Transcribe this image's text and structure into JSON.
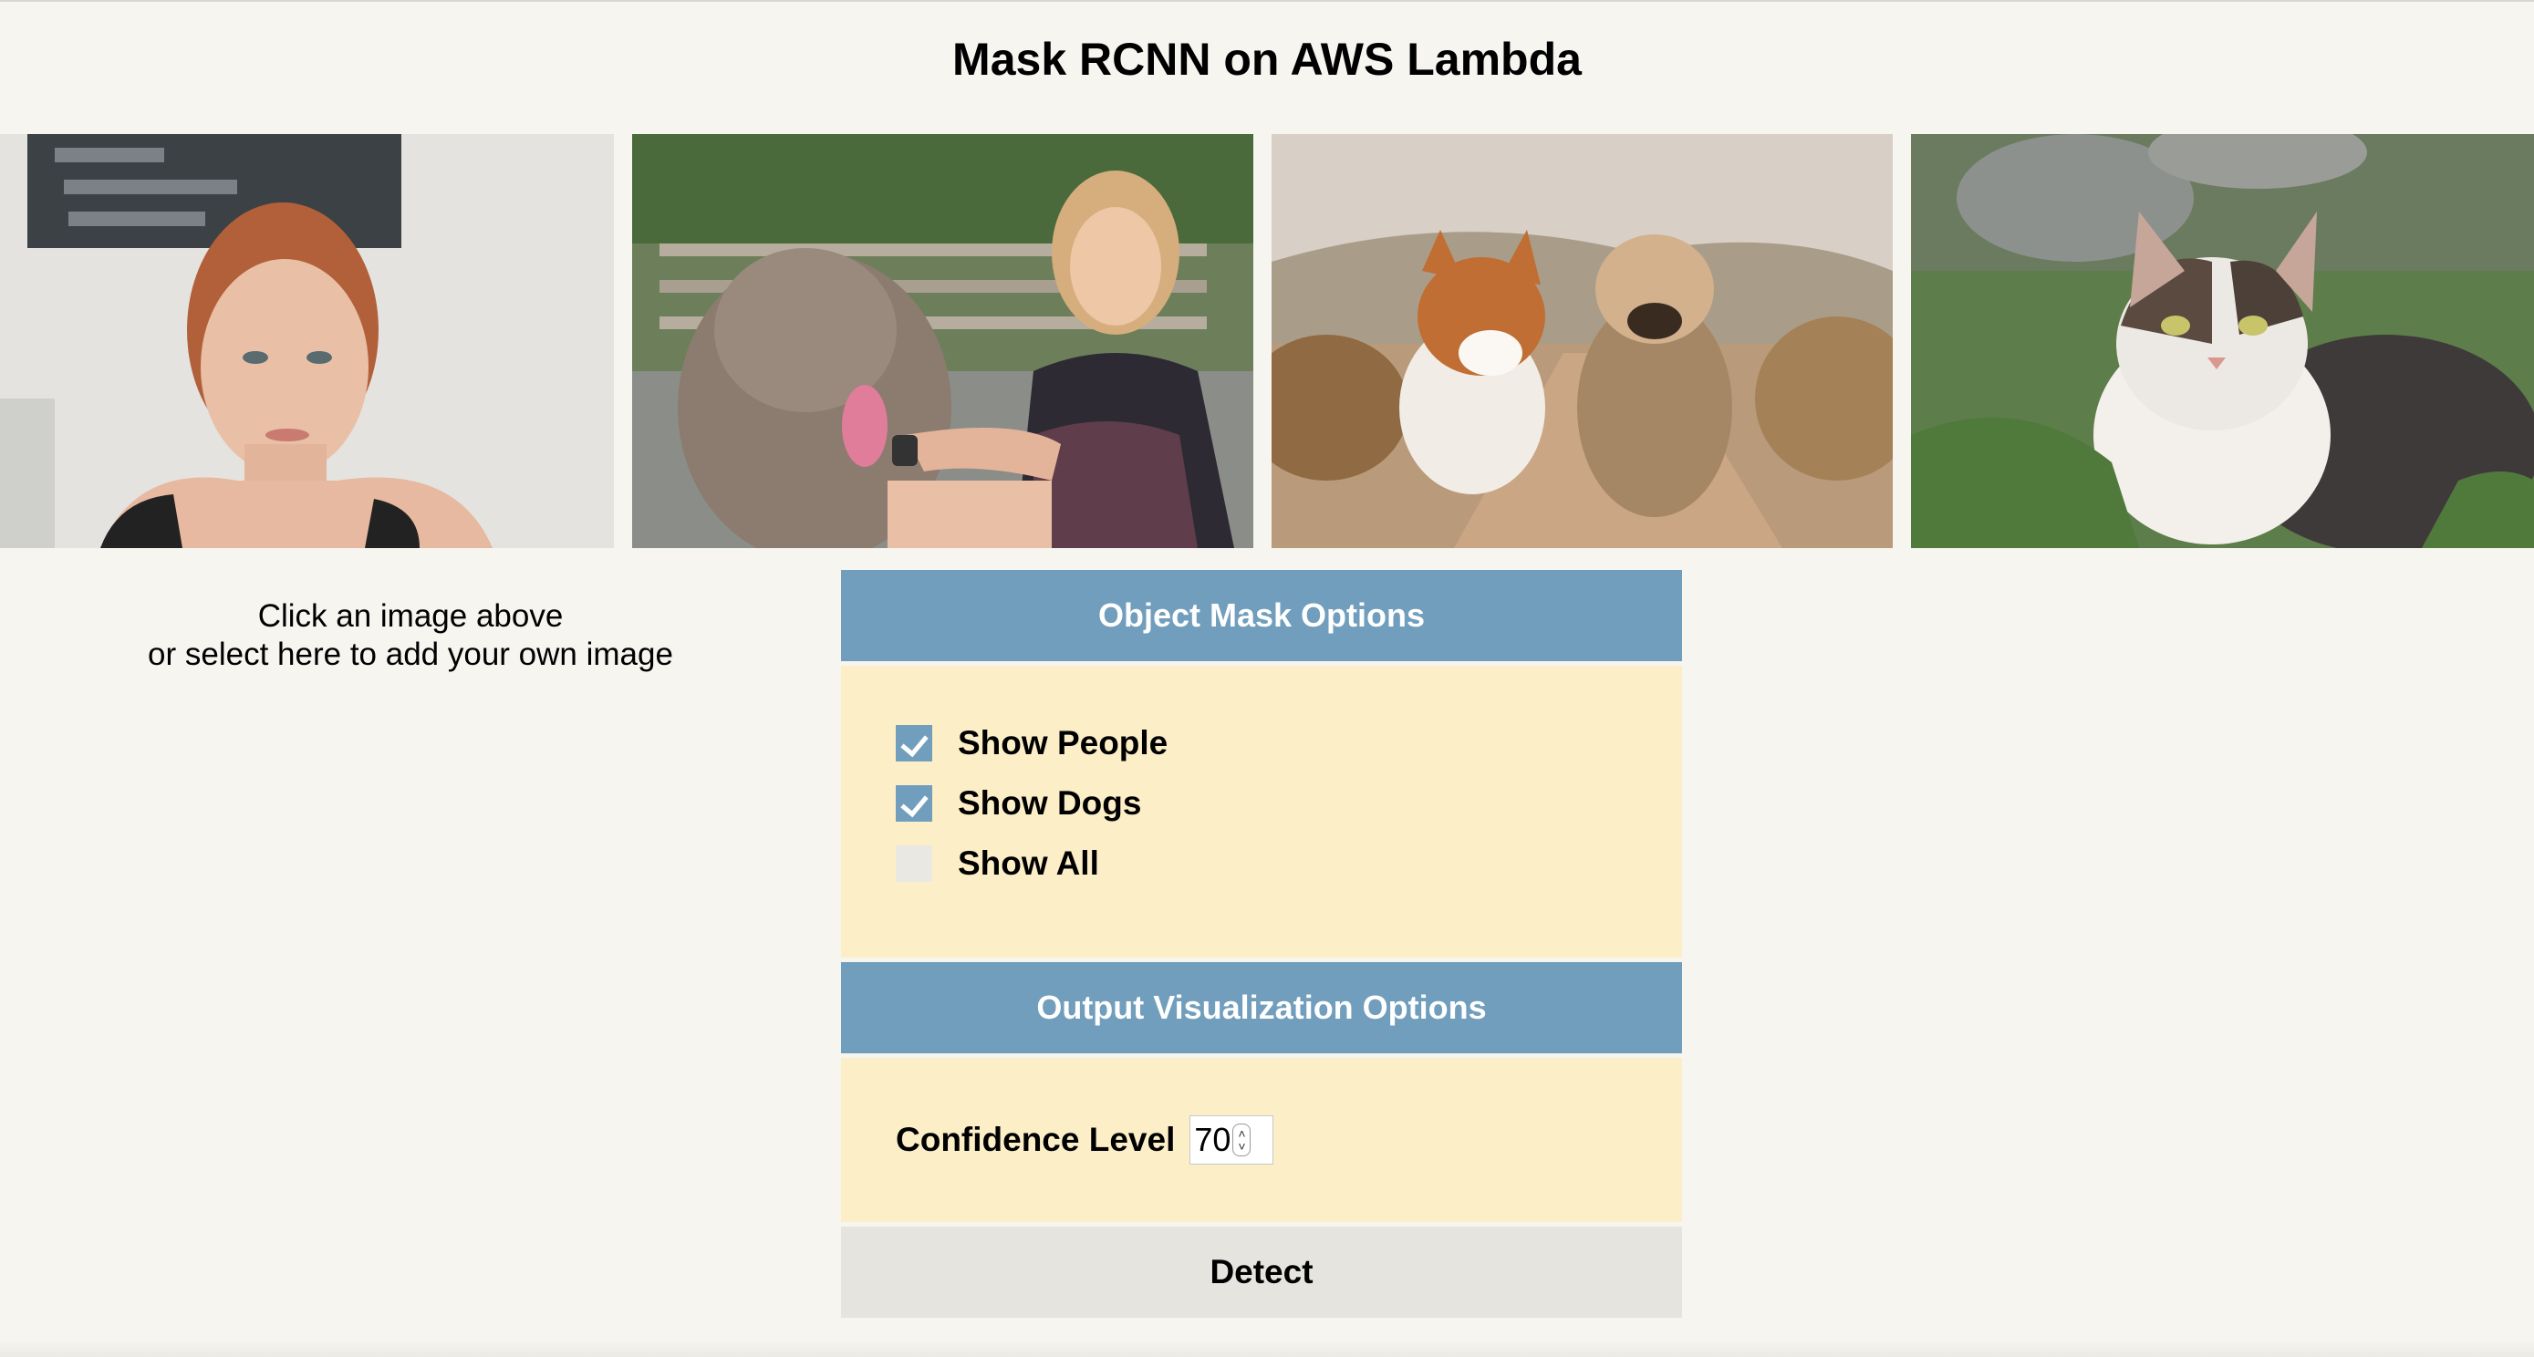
{
  "page": {
    "title": "Mask RCNN on AWS Lambda"
  },
  "gallery": {
    "images": [
      {
        "subject": "woman portrait",
        "icon": "person-photo"
      },
      {
        "subject": "woman with dog",
        "icon": "person-dog-photo"
      },
      {
        "subject": "two dogs on path",
        "icon": "dogs-photo"
      },
      {
        "subject": "cat in grass",
        "icon": "cat-photo"
      }
    ]
  },
  "upload": {
    "line1": "Click an image above",
    "line2": "or select here to add your own image"
  },
  "mask_options": {
    "header": "Object Mask Options",
    "options": [
      {
        "label": "Show People",
        "checked": true
      },
      {
        "label": "Show Dogs",
        "checked": true
      },
      {
        "label": "Show All",
        "checked": false
      }
    ]
  },
  "viz_options": {
    "header": "Output Visualization Options",
    "confidence_label": "Confidence Level",
    "confidence_value": "70"
  },
  "actions": {
    "detect_label": "Detect"
  },
  "colors": {
    "background": "#f6f5f0",
    "section_header": "#719ebd",
    "section_body": "#fcefc7",
    "button": "#e5e4df"
  }
}
